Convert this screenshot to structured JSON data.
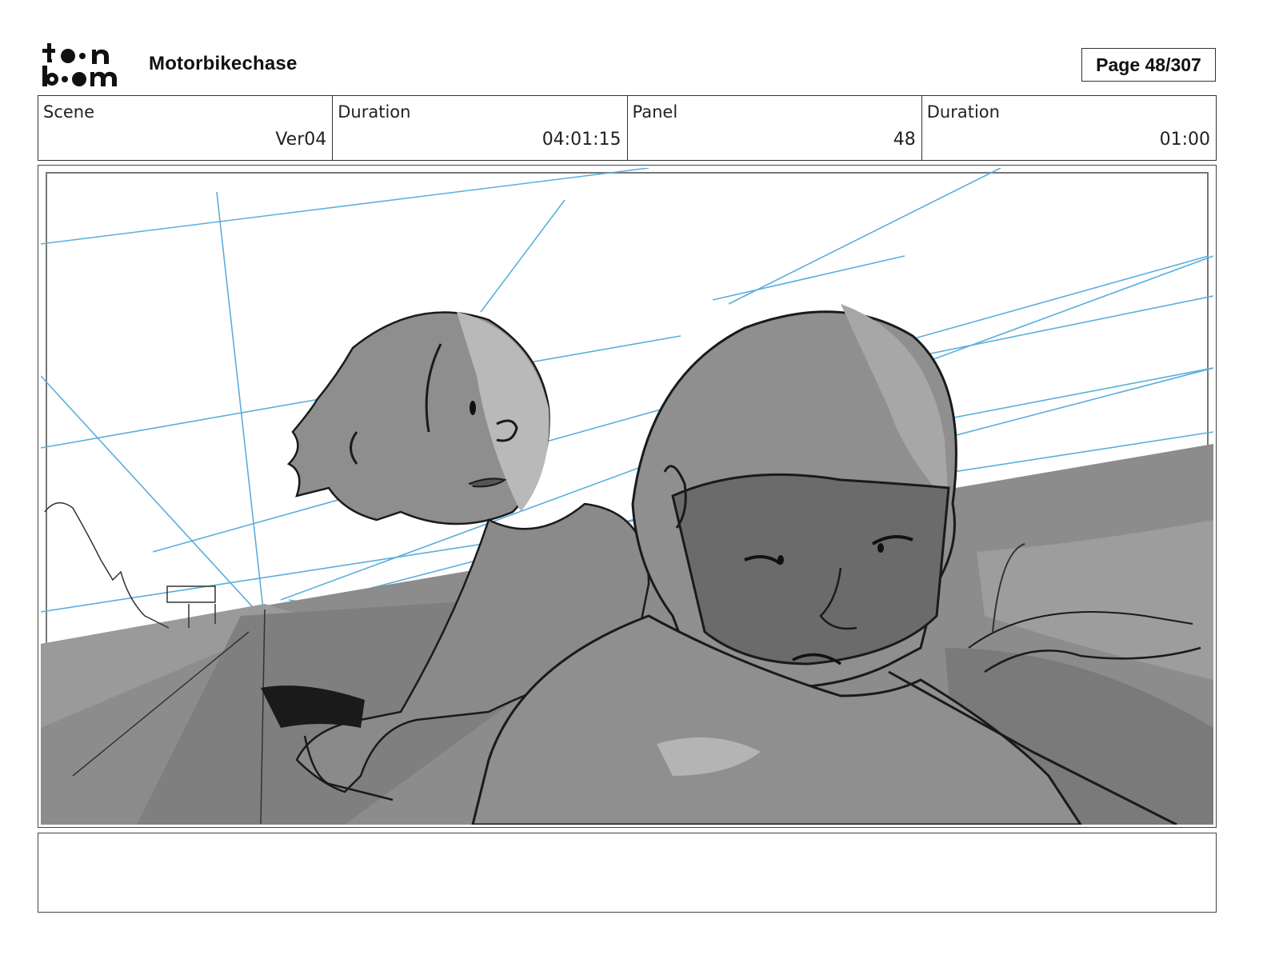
{
  "header": {
    "logo_text": "toon boom",
    "project_title": "Motorbikechase",
    "page_label": "Page 48/307"
  },
  "info": {
    "scene_label": "Scene",
    "scene_value": "Ver04",
    "scene_duration_label": "Duration",
    "scene_duration_value": "04:01:15",
    "panel_label": "Panel",
    "panel_value": "48",
    "panel_duration_label": "Duration",
    "panel_duration_value": "01:00"
  },
  "panel": {
    "image_subject": "storyboard sketch of a helmeted rider and a passenger on a motorbike"
  },
  "notes": {
    "text": ""
  },
  "colors": {
    "perspective_lines": "#5aaedc",
    "sketch_ink": "#1a1a1a",
    "tone_dark": "#6e6e6e",
    "tone_mid": "#8f8f8f",
    "tone_light": "#b7b7b7"
  }
}
